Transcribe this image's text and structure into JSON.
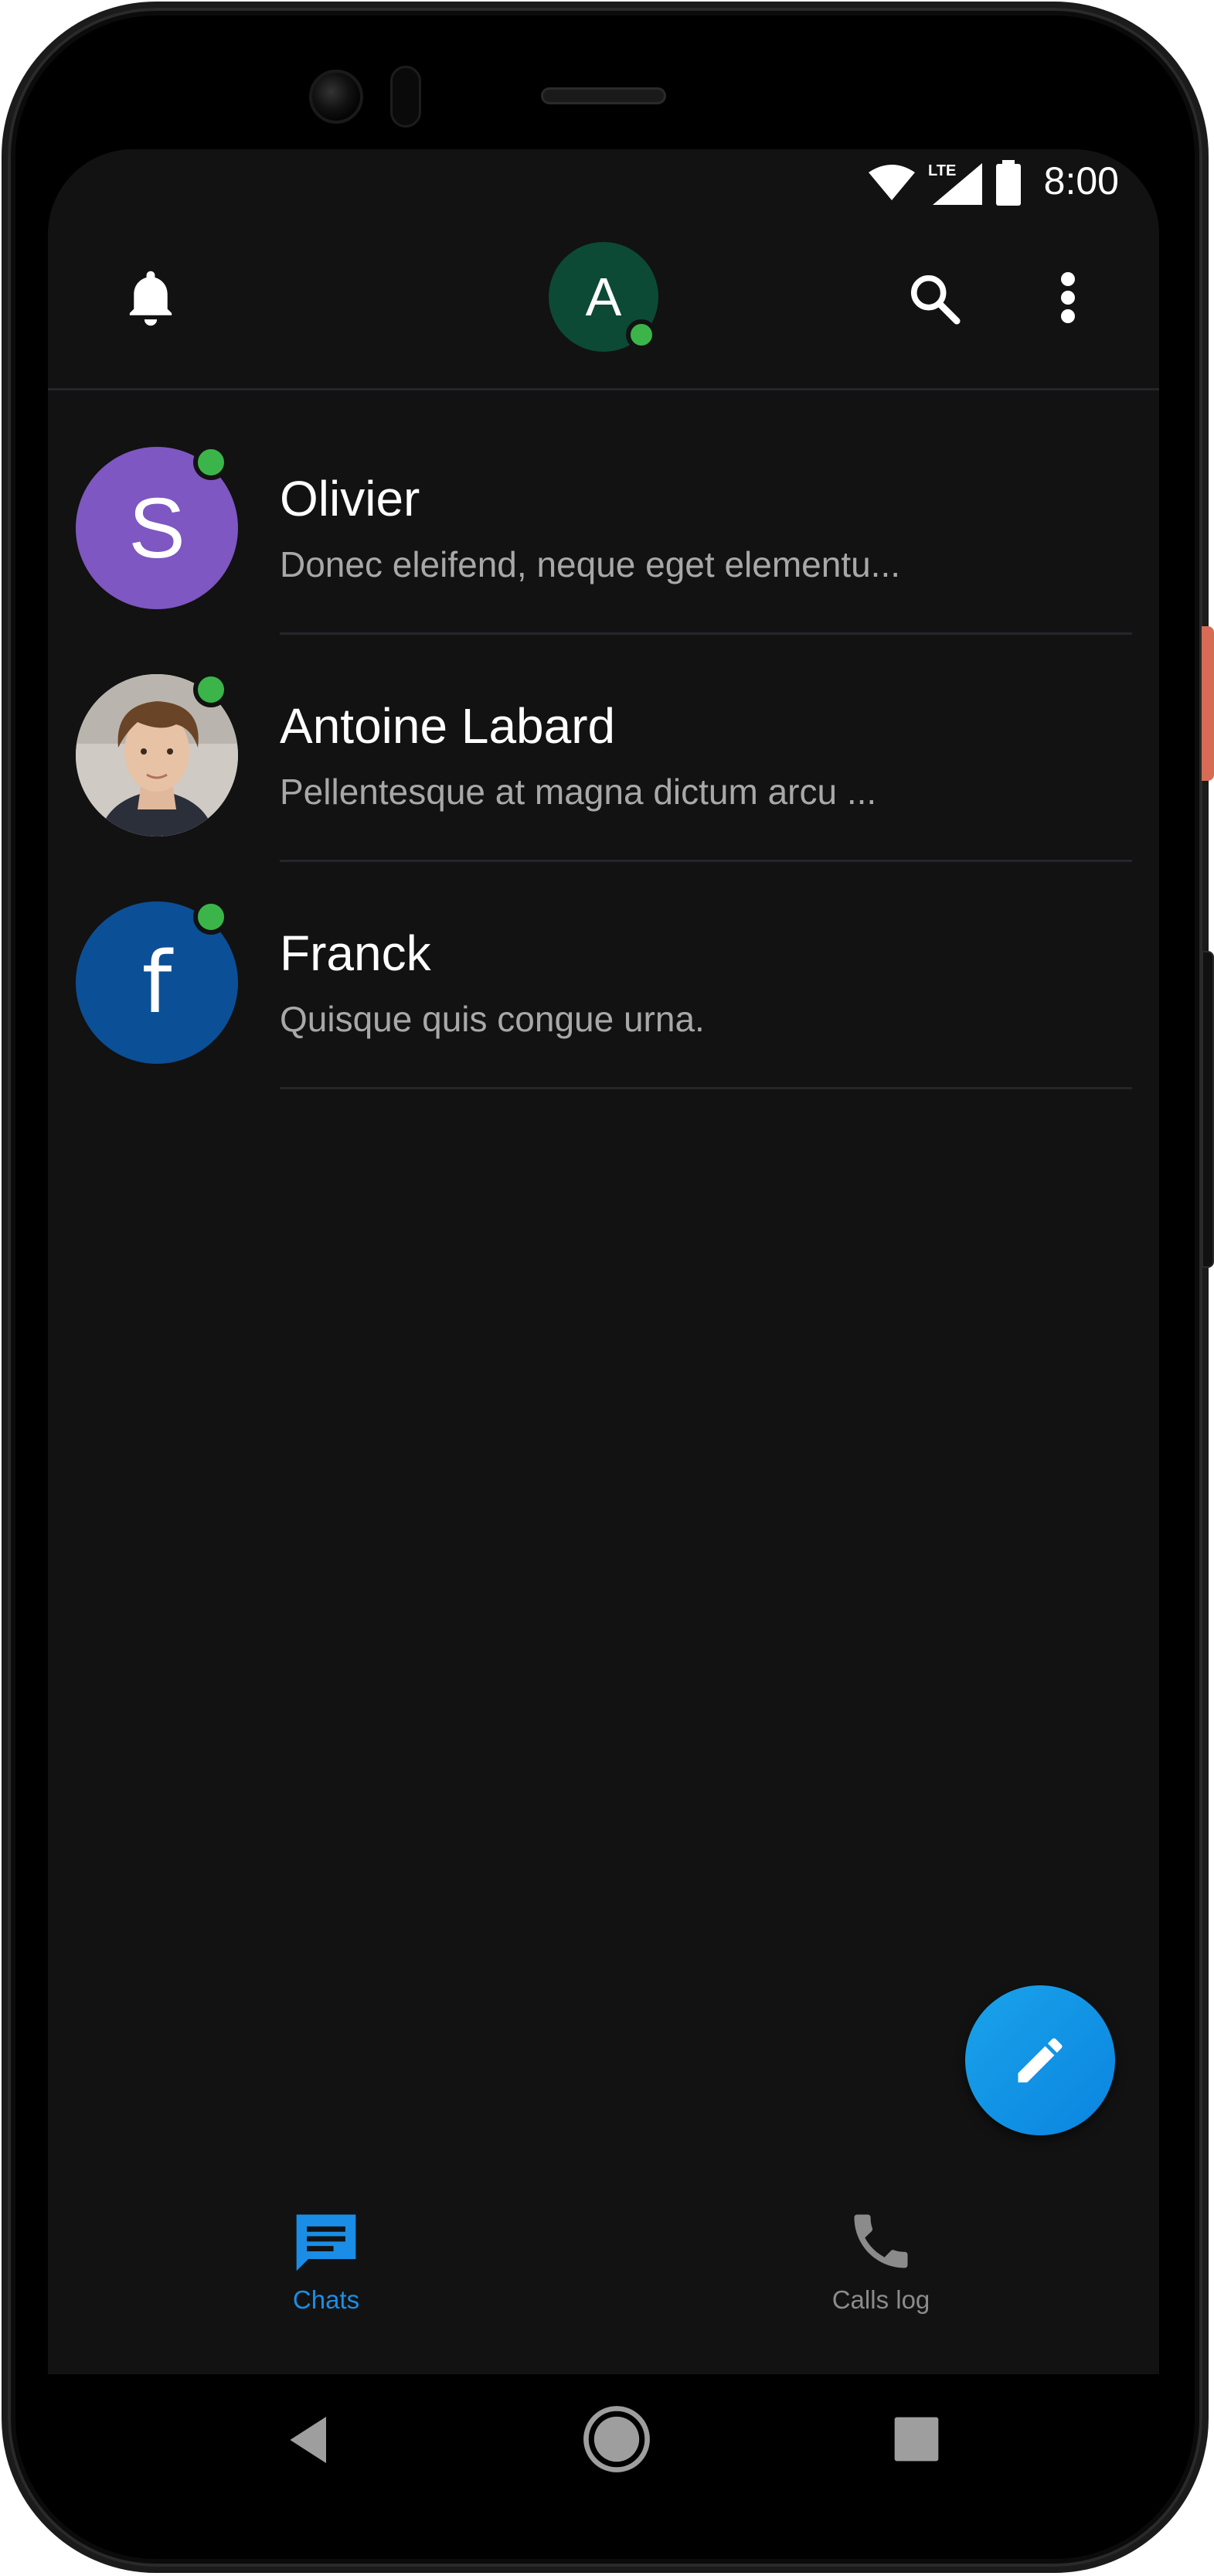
{
  "status_bar": {
    "time": "8:00",
    "network": "LTE"
  },
  "app_bar": {
    "account_initial": "A",
    "icons": [
      "bell-icon",
      "search-icon",
      "more-vert-icon"
    ]
  },
  "chats": [
    {
      "name": "Olivier",
      "preview": "Donec eleifend, neque eget elementu...",
      "avatar_letter": "S",
      "avatar_color": "#7e57c2",
      "online": true
    },
    {
      "name": "Antoine Labard",
      "preview": "Pellentesque at magna dictum arcu ...",
      "avatar_letter": "",
      "avatar_type": "photo",
      "online": true
    },
    {
      "name": "Franck",
      "preview": "Quisque quis congue urna.",
      "avatar_letter": "f",
      "avatar_color": "#0b4f97",
      "online": true
    }
  ],
  "fab": {
    "icon": "pencil-icon"
  },
  "bottom_nav": {
    "chats_label": "Chats",
    "calls_label": "Calls log",
    "active": "Chats"
  },
  "colors": {
    "accent": "#1a8ee6",
    "online": "#3bb54a",
    "background": "#121212"
  }
}
